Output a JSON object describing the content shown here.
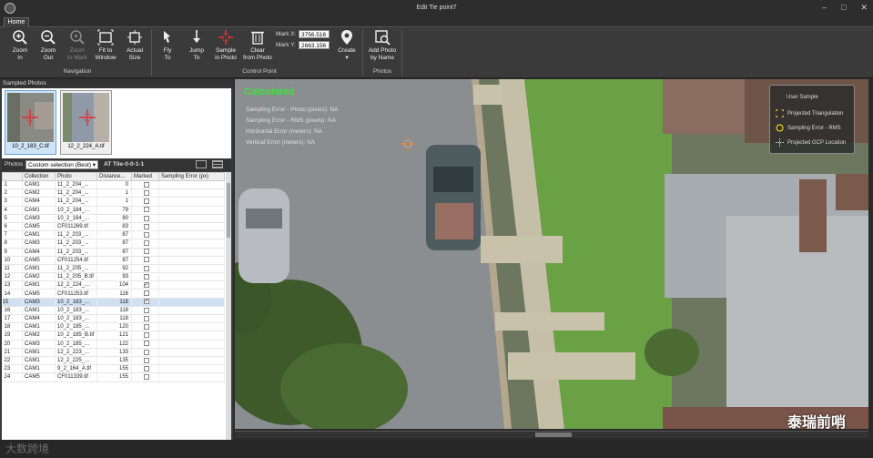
{
  "window": {
    "title": "Edit Tie point7",
    "tab": "Home"
  },
  "ribbon": {
    "navigation": {
      "label": "Navigation",
      "buttons": [
        {
          "name": "zoom-in-button",
          "l1": "Zoom",
          "l2": "In",
          "enabled": true
        },
        {
          "name": "zoom-out-button",
          "l1": "Zoom",
          "l2": "Out",
          "enabled": true
        },
        {
          "name": "zoom-to-mark-button",
          "l1": "Zoom",
          "l2": "to Mark",
          "enabled": false
        },
        {
          "name": "fit-to-window-button",
          "l1": "Fit to",
          "l2": "Window",
          "enabled": true
        },
        {
          "name": "actual-size-button",
          "l1": "Actual",
          "l2": "Size",
          "enabled": true
        }
      ]
    },
    "control_point": {
      "label": "Control Point",
      "buttons": [
        {
          "name": "fly-to-button",
          "l1": "Fly",
          "l2": "To"
        },
        {
          "name": "jump-to-button",
          "l1": "Jump",
          "l2": "To"
        },
        {
          "name": "sample-in-photo-button",
          "l1": "Sample",
          "l2": "in Photo"
        },
        {
          "name": "clear-from-photo-button",
          "l1": "Clear",
          "l2": "from Photo"
        }
      ],
      "mark_x_label": "Mark X:",
      "mark_x": "3756.516",
      "mark_y_label": "Mark Y:",
      "mark_y": "2663.156",
      "create_label": "Create"
    },
    "photos": {
      "label": "Photos",
      "add_l1": "Add Photo",
      "add_l2": "by Name"
    }
  },
  "left": {
    "sampled_label": "Sampled Photos",
    "thumbs": [
      {
        "caption": "10_2_183_C.tif"
      },
      {
        "caption": "12_2_224_A.tif"
      }
    ],
    "photos_label": "Photos",
    "filter": "Custom selection (Best)",
    "tile": "AT Tile-0-0-1-1",
    "columns": [
      "",
      "Collection",
      "Photo",
      "Distance...",
      "Marked",
      "Sampling Error (px)"
    ],
    "rows": [
      [
        "1",
        "CAM1",
        "11_2_204_...",
        "0",
        false
      ],
      [
        "2",
        "CAM2",
        "11_2_204_...",
        "1",
        false
      ],
      [
        "3",
        "CAM4",
        "11_2_204_...",
        "1",
        false
      ],
      [
        "4",
        "CAM1",
        "10_2_184_...",
        "79",
        false
      ],
      [
        "5",
        "CAM3",
        "10_2_184_...",
        "80",
        false
      ],
      [
        "6",
        "CAM5",
        "CF011269.tif",
        "83",
        false
      ],
      [
        "7",
        "CAM1",
        "11_2_203_...",
        "87",
        false
      ],
      [
        "8",
        "CAM3",
        "11_2_203_...",
        "87",
        false
      ],
      [
        "9",
        "CAM4",
        "11_2_203_...",
        "87",
        false
      ],
      [
        "10",
        "CAM5",
        "CF011254.tif",
        "87",
        false
      ],
      [
        "11",
        "CAM1",
        "11_2_205_...",
        "92",
        false
      ],
      [
        "12",
        "CAM2",
        "11_2_205_B.tif",
        "93",
        false
      ],
      [
        "13",
        "CAM1",
        "12_2_224_...",
        "104",
        true
      ],
      [
        "14",
        "CAM5",
        "CF011253.tif",
        "116",
        false
      ],
      [
        "15",
        "CAM3",
        "10_2_183_...",
        "118",
        true
      ],
      [
        "16",
        "CAM1",
        "10_2_183_...",
        "118",
        false
      ],
      [
        "17",
        "CAM4",
        "10_2_183_...",
        "118",
        false
      ],
      [
        "18",
        "CAM1",
        "10_2_185_...",
        "120",
        false
      ],
      [
        "19",
        "CAM2",
        "10_2_185_B.tif",
        "121",
        false
      ],
      [
        "20",
        "CAM3",
        "10_2_185_...",
        "122",
        false
      ],
      [
        "21",
        "CAM1",
        "12_2_223_...",
        "133",
        false
      ],
      [
        "22",
        "CAM1",
        "12_2_225_...",
        "135",
        false
      ],
      [
        "23",
        "CAM1",
        "9_2_164_A.tif",
        "155",
        false
      ],
      [
        "24",
        "CAM5",
        "CF011339.tif",
        "155",
        false
      ]
    ],
    "selected_row": 14
  },
  "view": {
    "calculated": "Calculated",
    "lines": [
      "Sampling Error - Photo (pixels): NA",
      "Sampling Error - RMS (pixels): NA",
      "Horizontal Error (meters): NA",
      "Vertical Error (meters): NA"
    ],
    "legend": [
      "User Sample",
      "Projected Triangulation",
      "Sampling Error - RMS",
      "Projected GCP Location"
    ]
  },
  "watermark": "泰瑞前哨",
  "watermark2": "大数跨境"
}
